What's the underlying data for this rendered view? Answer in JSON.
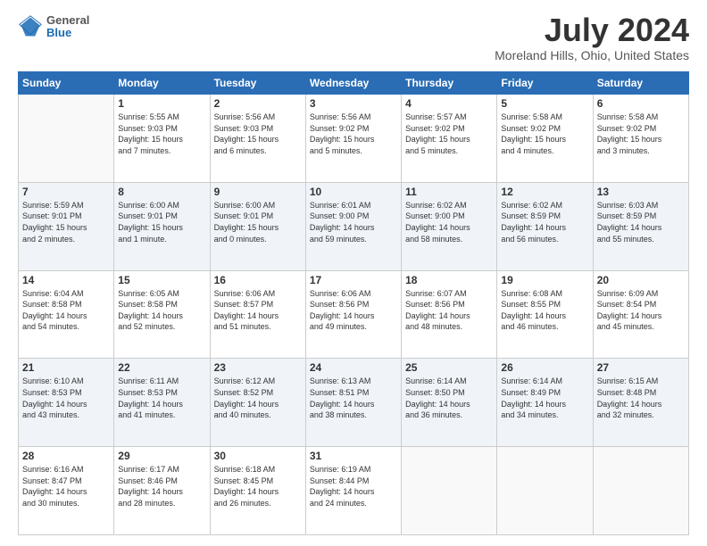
{
  "logo": {
    "line1": "General",
    "line2": "Blue"
  },
  "title": "July 2024",
  "subtitle": "Moreland Hills, Ohio, United States",
  "days_header": [
    "Sunday",
    "Monday",
    "Tuesday",
    "Wednesday",
    "Thursday",
    "Friday",
    "Saturday"
  ],
  "weeks": [
    [
      {
        "num": "",
        "info": ""
      },
      {
        "num": "1",
        "info": "Sunrise: 5:55 AM\nSunset: 9:03 PM\nDaylight: 15 hours\nand 7 minutes."
      },
      {
        "num": "2",
        "info": "Sunrise: 5:56 AM\nSunset: 9:03 PM\nDaylight: 15 hours\nand 6 minutes."
      },
      {
        "num": "3",
        "info": "Sunrise: 5:56 AM\nSunset: 9:02 PM\nDaylight: 15 hours\nand 5 minutes."
      },
      {
        "num": "4",
        "info": "Sunrise: 5:57 AM\nSunset: 9:02 PM\nDaylight: 15 hours\nand 5 minutes."
      },
      {
        "num": "5",
        "info": "Sunrise: 5:58 AM\nSunset: 9:02 PM\nDaylight: 15 hours\nand 4 minutes."
      },
      {
        "num": "6",
        "info": "Sunrise: 5:58 AM\nSunset: 9:02 PM\nDaylight: 15 hours\nand 3 minutes."
      }
    ],
    [
      {
        "num": "7",
        "info": "Sunrise: 5:59 AM\nSunset: 9:01 PM\nDaylight: 15 hours\nand 2 minutes."
      },
      {
        "num": "8",
        "info": "Sunrise: 6:00 AM\nSunset: 9:01 PM\nDaylight: 15 hours\nand 1 minute."
      },
      {
        "num": "9",
        "info": "Sunrise: 6:00 AM\nSunset: 9:01 PM\nDaylight: 15 hours\nand 0 minutes."
      },
      {
        "num": "10",
        "info": "Sunrise: 6:01 AM\nSunset: 9:00 PM\nDaylight: 14 hours\nand 59 minutes."
      },
      {
        "num": "11",
        "info": "Sunrise: 6:02 AM\nSunset: 9:00 PM\nDaylight: 14 hours\nand 58 minutes."
      },
      {
        "num": "12",
        "info": "Sunrise: 6:02 AM\nSunset: 8:59 PM\nDaylight: 14 hours\nand 56 minutes."
      },
      {
        "num": "13",
        "info": "Sunrise: 6:03 AM\nSunset: 8:59 PM\nDaylight: 14 hours\nand 55 minutes."
      }
    ],
    [
      {
        "num": "14",
        "info": "Sunrise: 6:04 AM\nSunset: 8:58 PM\nDaylight: 14 hours\nand 54 minutes."
      },
      {
        "num": "15",
        "info": "Sunrise: 6:05 AM\nSunset: 8:58 PM\nDaylight: 14 hours\nand 52 minutes."
      },
      {
        "num": "16",
        "info": "Sunrise: 6:06 AM\nSunset: 8:57 PM\nDaylight: 14 hours\nand 51 minutes."
      },
      {
        "num": "17",
        "info": "Sunrise: 6:06 AM\nSunset: 8:56 PM\nDaylight: 14 hours\nand 49 minutes."
      },
      {
        "num": "18",
        "info": "Sunrise: 6:07 AM\nSunset: 8:56 PM\nDaylight: 14 hours\nand 48 minutes."
      },
      {
        "num": "19",
        "info": "Sunrise: 6:08 AM\nSunset: 8:55 PM\nDaylight: 14 hours\nand 46 minutes."
      },
      {
        "num": "20",
        "info": "Sunrise: 6:09 AM\nSunset: 8:54 PM\nDaylight: 14 hours\nand 45 minutes."
      }
    ],
    [
      {
        "num": "21",
        "info": "Sunrise: 6:10 AM\nSunset: 8:53 PM\nDaylight: 14 hours\nand 43 minutes."
      },
      {
        "num": "22",
        "info": "Sunrise: 6:11 AM\nSunset: 8:53 PM\nDaylight: 14 hours\nand 41 minutes."
      },
      {
        "num": "23",
        "info": "Sunrise: 6:12 AM\nSunset: 8:52 PM\nDaylight: 14 hours\nand 40 minutes."
      },
      {
        "num": "24",
        "info": "Sunrise: 6:13 AM\nSunset: 8:51 PM\nDaylight: 14 hours\nand 38 minutes."
      },
      {
        "num": "25",
        "info": "Sunrise: 6:14 AM\nSunset: 8:50 PM\nDaylight: 14 hours\nand 36 minutes."
      },
      {
        "num": "26",
        "info": "Sunrise: 6:14 AM\nSunset: 8:49 PM\nDaylight: 14 hours\nand 34 minutes."
      },
      {
        "num": "27",
        "info": "Sunrise: 6:15 AM\nSunset: 8:48 PM\nDaylight: 14 hours\nand 32 minutes."
      }
    ],
    [
      {
        "num": "28",
        "info": "Sunrise: 6:16 AM\nSunset: 8:47 PM\nDaylight: 14 hours\nand 30 minutes."
      },
      {
        "num": "29",
        "info": "Sunrise: 6:17 AM\nSunset: 8:46 PM\nDaylight: 14 hours\nand 28 minutes."
      },
      {
        "num": "30",
        "info": "Sunrise: 6:18 AM\nSunset: 8:45 PM\nDaylight: 14 hours\nand 26 minutes."
      },
      {
        "num": "31",
        "info": "Sunrise: 6:19 AM\nSunset: 8:44 PM\nDaylight: 14 hours\nand 24 minutes."
      },
      {
        "num": "",
        "info": ""
      },
      {
        "num": "",
        "info": ""
      },
      {
        "num": "",
        "info": ""
      }
    ]
  ]
}
